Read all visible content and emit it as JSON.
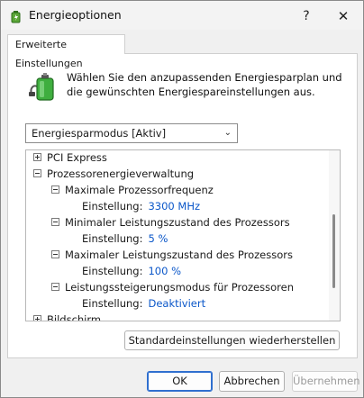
{
  "window": {
    "title": "Energieoptionen",
    "help_glyph": "?",
    "close_glyph": "✕"
  },
  "tab": {
    "label": "Erweiterte Einstellungen"
  },
  "intro": {
    "text": "Wählen Sie den anzupassenden Energiesparplan und die gewünschten Energiespareinstellungen aus."
  },
  "plan_select": {
    "value": "Energiesparmodus [Aktiv]",
    "chevron": "⌄"
  },
  "tree": {
    "pci_express": "PCI Express",
    "proc_mgmt": "Prozessorenergieverwaltung",
    "max_freq": "Maximale Prozessorfrequenz",
    "max_freq_key": "Einstellung:",
    "max_freq_val": "3300 MHz",
    "min_state": "Minimaler Leistungszustand des Prozessors",
    "min_state_key": "Einstellung:",
    "min_state_val": "5 %",
    "max_state": "Maximaler Leistungszustand des Prozessors",
    "max_state_key": "Einstellung:",
    "max_state_val": "100 %",
    "boost_mode": "Leistungssteigerungsmodus für Prozessoren",
    "boost_mode_key": "Einstellung:",
    "boost_mode_val": "Deaktiviert",
    "display": "Bildschirm"
  },
  "buttons": {
    "restore": "Standardeinstellungen wiederherstellen",
    "ok": "OK",
    "cancel": "Abbrechen",
    "apply": "Übernehmen"
  },
  "colors": {
    "link": "#0b57c9",
    "accent": "#2f6fcf",
    "battery_green": "#3fae3f"
  },
  "icons": {
    "title": "power-options-icon",
    "header": "battery-plug-icon"
  }
}
